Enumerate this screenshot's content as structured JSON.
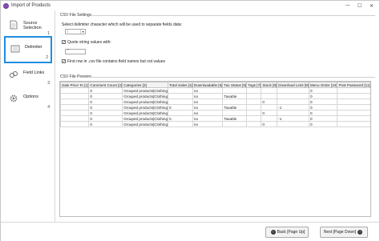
{
  "window": {
    "title": "Import of Products",
    "minimize": "—",
    "maximize": "☐",
    "close": "✕"
  },
  "sidebar": {
    "items": [
      {
        "label1": "Source",
        "label2": "Selection",
        "num": "1",
        "icon": "document-icon"
      },
      {
        "label1": "Delimiter",
        "label2": "",
        "num": "2",
        "icon": "delimiter-icon"
      },
      {
        "label1": "Field Links",
        "label2": "",
        "num": "3",
        "icon": "link-icon"
      },
      {
        "label1": "Options",
        "label2": "",
        "num": "4",
        "icon": "gear-icon"
      }
    ]
  },
  "settings": {
    "title": "CSV File Settings",
    "delimiter_label": "Select delimiter character which will be used to separate fields data:",
    "delimiter_value": ";",
    "quote_label": "Quote string values with:",
    "quote_value": "\"",
    "first_row_label": "First row in .csv file contains field names but not values",
    "quote_checked": "✓",
    "first_row_checked": "✓"
  },
  "preview": {
    "title": "CSV File Preview",
    "columns": [
      "Sale Price To [1]",
      "Comment Count [2]",
      "Categories [3]",
      "Total Sales [4]",
      "Downloadable [5]",
      "Tax Status [6]",
      "Tags [7]",
      "Stock [8]",
      "Download Limit [9]",
      "Menu Order [10]",
      "Post Password [11]"
    ],
    "rows": [
      [
        "",
        "0",
        "Grouped products|Clothing",
        "",
        "no",
        "",
        "",
        "",
        "",
        "0",
        ""
      ],
      [
        "",
        "0",
        "Grouped products|Clothing",
        "",
        "no",
        "Taxable",
        "",
        "",
        "",
        "0",
        ""
      ],
      [
        "",
        "0",
        "Grouped products|Clothing",
        "",
        "no",
        "",
        "",
        "0",
        "",
        "0",
        ""
      ],
      [
        "",
        "0",
        "Grouped products|Clothing",
        "0",
        "no",
        "Taxable",
        "",
        "",
        "-1",
        "0",
        ""
      ],
      [
        "",
        "0",
        "Grouped products|Clothing",
        "",
        "no",
        "",
        "",
        "0",
        "",
        "0",
        ""
      ],
      [
        "",
        "0",
        "Grouped products|Clothing",
        "0",
        "no",
        "Taxable",
        "",
        "",
        "-1",
        "0",
        ""
      ],
      [
        "",
        "0",
        "Grouped products|Clothing",
        "",
        "no",
        "",
        "",
        "0",
        "",
        "0",
        ""
      ]
    ]
  },
  "footer": {
    "back_label": "Back [Page Up]",
    "next_label": "Next [Page Down]"
  },
  "colors": {
    "accent": "#1f8ce0",
    "app_icon": "#8a4fb6"
  }
}
